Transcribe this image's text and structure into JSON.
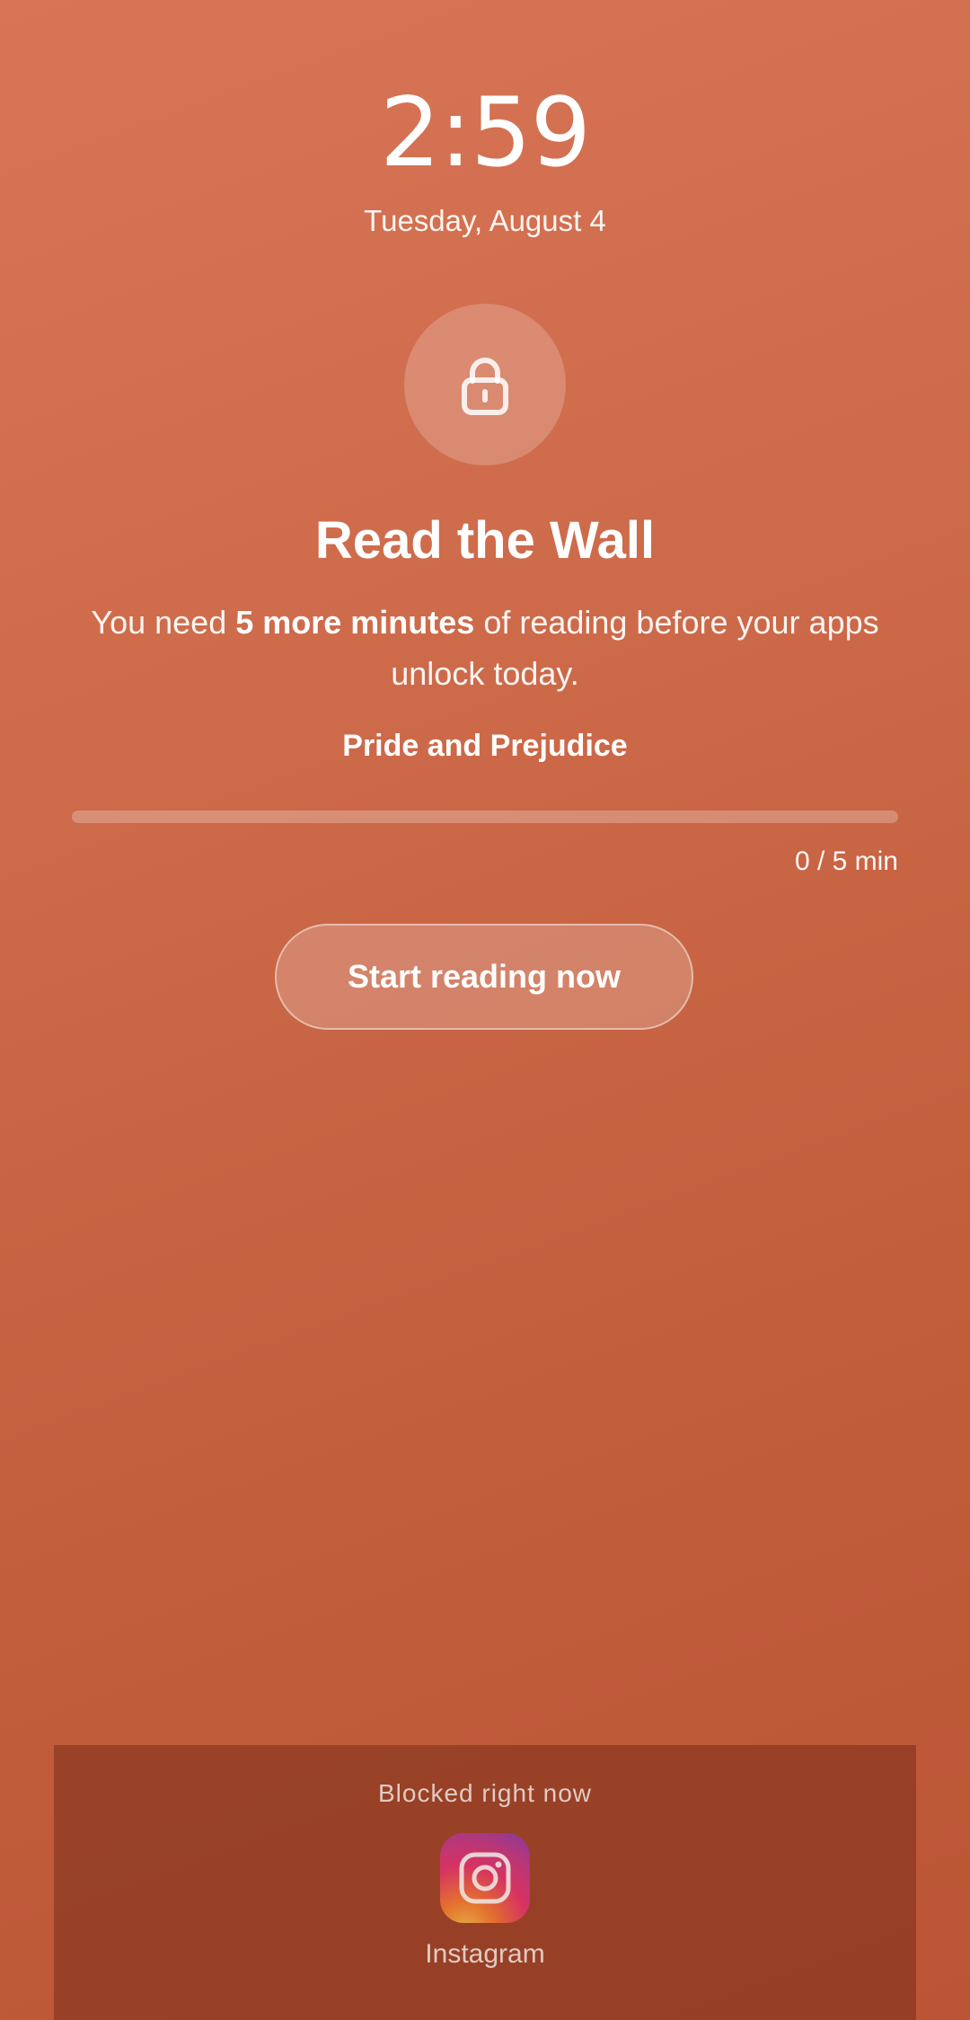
{
  "lockscreen": {
    "time": "2:59",
    "date": "Tuesday, August 4"
  },
  "wall": {
    "icon": "lock-icon",
    "title": "Read the Wall",
    "message_prefix": "You need ",
    "message_bold": "5 more minutes",
    "message_suffix": " of reading before your apps unlock today.",
    "book_title": "Pride and Prejudice",
    "progress_fraction": 0,
    "progress_text": "0 / 5 min",
    "start_button_label": "Start reading now"
  },
  "blocked": {
    "label": "Blocked right now",
    "apps": [
      {
        "name": "Instagram",
        "icon": "instagram-icon"
      }
    ]
  },
  "colors": {
    "background_top": "#d87556",
    "background_bottom": "#bb5535",
    "panel": "#8c3d27",
    "text": "#ffffff"
  }
}
